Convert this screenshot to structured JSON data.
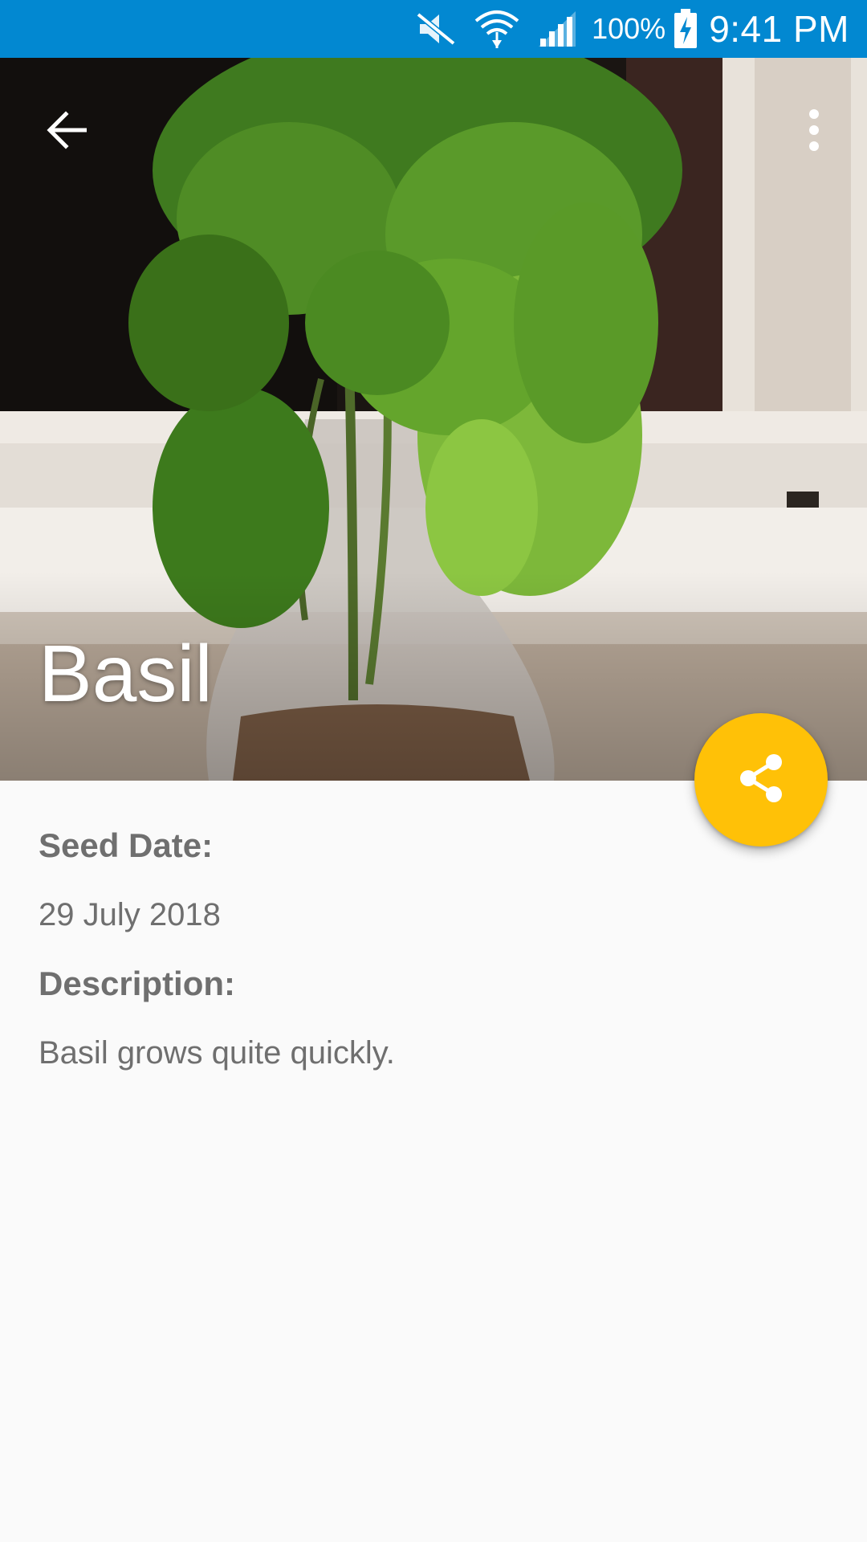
{
  "status_bar": {
    "battery_percent": "100%",
    "time": "9:41 PM",
    "icons": [
      "mute-icon",
      "wifi-icon",
      "signal-icon",
      "battery-charging-icon"
    ],
    "background_color": "#0288d1"
  },
  "toolbar": {
    "back_icon": "arrow-back-icon",
    "overflow_icon": "more-vert-icon"
  },
  "hero": {
    "title": "Basil",
    "image_description_icon": "plant-photo"
  },
  "fab": {
    "icon": "share-icon",
    "color": "#ffc107"
  },
  "details": {
    "seed_date_label": "Seed Date:",
    "seed_date_value": "29 July 2018",
    "description_label": "Description:",
    "description_value": "Basil grows quite quickly."
  }
}
